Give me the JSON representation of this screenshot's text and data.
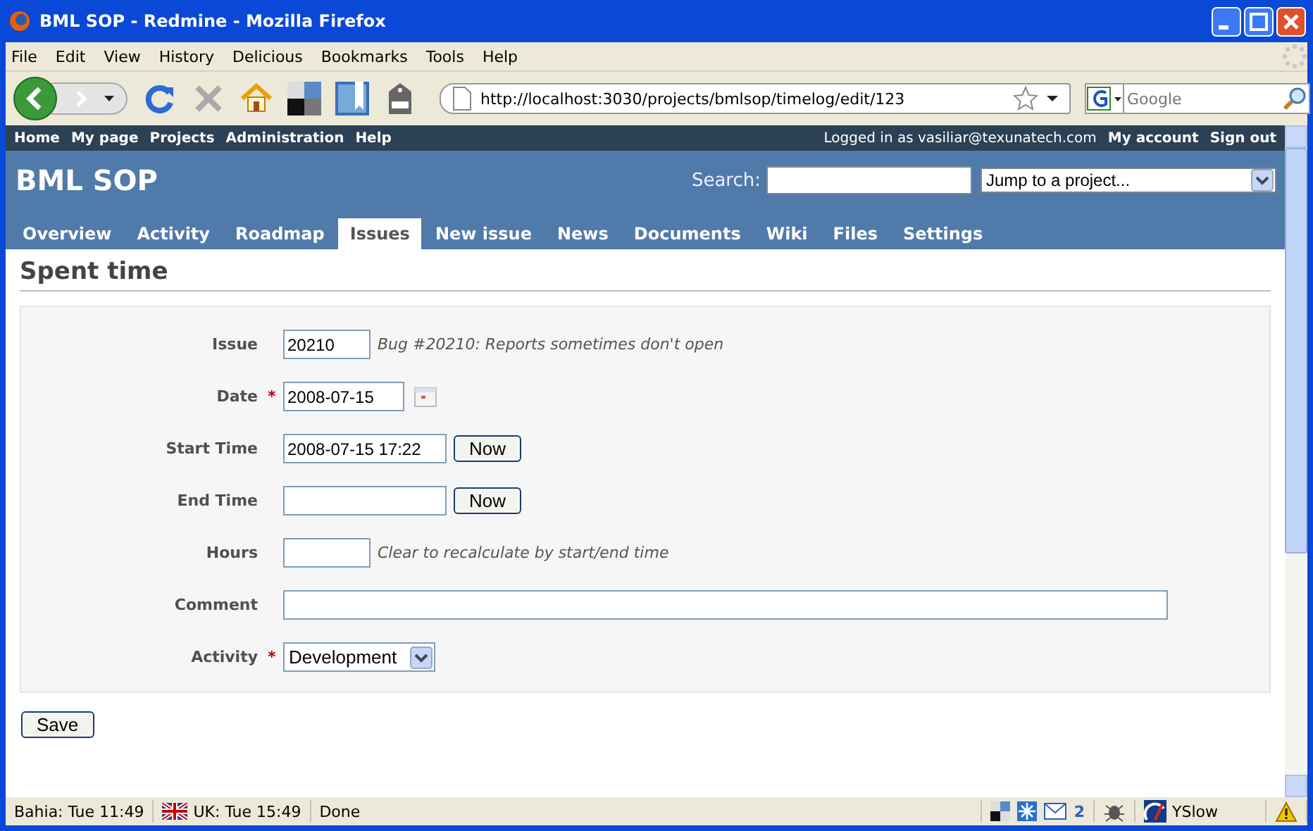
{
  "window": {
    "title": "BML SOP - Redmine - Mozilla Firefox"
  },
  "menu_bar": [
    "File",
    "Edit",
    "View",
    "History",
    "Delicious",
    "Bookmarks",
    "Tools",
    "Help"
  ],
  "toolbar": {
    "url": "http://localhost:3030/projects/bmlsop/timelog/edit/123",
    "search_placeholder": "Google"
  },
  "top_menu": {
    "left": [
      "Home",
      "My page",
      "Projects",
      "Administration",
      "Help"
    ],
    "logged_in": "Logged in as vasiliar@texunatech.com",
    "right": [
      "My account",
      "Sign out"
    ]
  },
  "header": {
    "project": "BML SOP",
    "search_label": "Search:",
    "jump": "Jump to a project..."
  },
  "tabs": [
    {
      "label": "Overview",
      "selected": false
    },
    {
      "label": "Activity",
      "selected": false
    },
    {
      "label": "Roadmap",
      "selected": false
    },
    {
      "label": "Issues",
      "selected": true
    },
    {
      "label": "New issue",
      "selected": false
    },
    {
      "label": "News",
      "selected": false
    },
    {
      "label": "Documents",
      "selected": false
    },
    {
      "label": "Wiki",
      "selected": false
    },
    {
      "label": "Files",
      "selected": false
    },
    {
      "label": "Settings",
      "selected": false
    }
  ],
  "heading": "Spent time",
  "fields": [
    {
      "kind": "short",
      "label": "Issue",
      "value": "20210",
      "note": "Bug #20210: Reports sometimes don't open"
    },
    {
      "kind": "date",
      "label": "Date",
      "required_mark": "*",
      "value": "2008-07-15"
    },
    {
      "kind": "time",
      "label": "Start Time",
      "value": "2008-07-15 17:22",
      "button": "Now"
    },
    {
      "kind": "time",
      "label": "End Time",
      "button": "Now"
    },
    {
      "kind": "short",
      "label": "Hours",
      "note": "Clear to recalculate by start/end time"
    },
    {
      "kind": "wide",
      "label": "Comment"
    },
    {
      "kind": "select",
      "label": "Activity",
      "required_mark": "*",
      "value": "Development"
    }
  ],
  "save": "Save",
  "status_bar": {
    "left": [
      "Bahia: Tue 11:49",
      "UK: Tue 15:49",
      "Done"
    ],
    "mail_count": "2",
    "yslow": "YSlow"
  }
}
